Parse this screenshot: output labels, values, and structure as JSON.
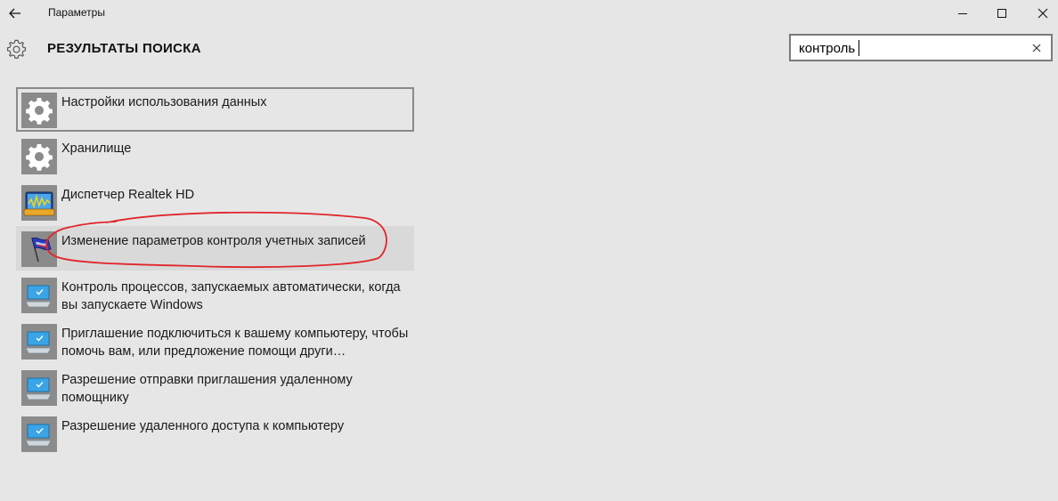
{
  "window": {
    "title": "Параметры",
    "controls": {
      "minimize_icon": "minimize-icon",
      "maximize_icon": "maximize-icon",
      "close_icon": "close-icon"
    }
  },
  "header": {
    "title": "РЕЗУЛЬТАТЫ ПОИСКА",
    "icon": "gear-icon"
  },
  "search": {
    "value": "контроль",
    "clear_icon": "clear-icon"
  },
  "results": [
    {
      "label": "Настройки использования данных",
      "icon": "gear-icon"
    },
    {
      "label": "Хранилище",
      "icon": "gear-icon"
    },
    {
      "label": "Диспетчер Realtek HD",
      "icon": "realtek-audio-icon"
    },
    {
      "label": "Изменение параметров контроля учетных записей",
      "icon": "uac-flag-icon"
    },
    {
      "label": "Контроль процессов, запускаемых автоматически, когда вы запускаете Windows",
      "icon": "computer-icon"
    },
    {
      "label": "Приглашение подключиться к вашему компьютеру, чтобы помочь вам, или предложение помощи други…",
      "icon": "computer-icon"
    },
    {
      "label": "Разрешение отправки приглашения удаленному помощнику",
      "icon": "computer-icon"
    },
    {
      "label": "Разрешение удаленного доступа к компьютеру",
      "icon": "computer-icon"
    }
  ],
  "colors": {
    "background": "#e6e6e6",
    "icon_tile": "#8b8b8b",
    "annotation": "#e0262b"
  }
}
